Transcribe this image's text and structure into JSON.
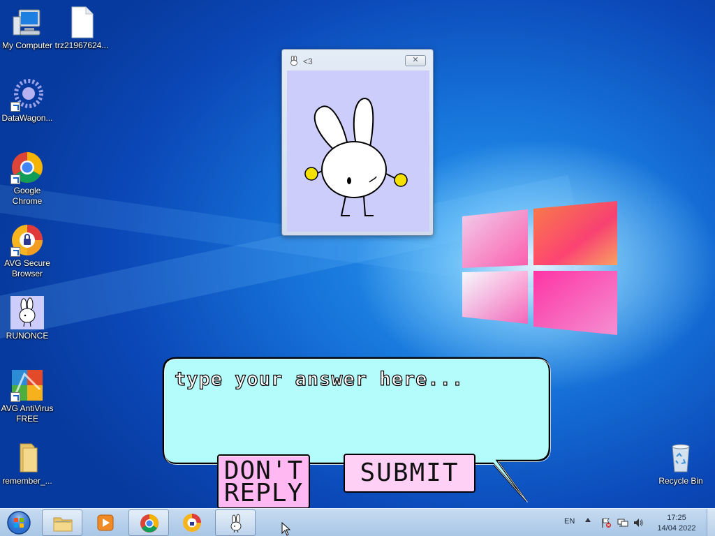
{
  "desktop": {
    "icons": [
      {
        "label": "My Computer",
        "icon": "computer-icon"
      },
      {
        "label": "trz21967624...",
        "icon": "file-icon"
      },
      {
        "label": "DataWagon...",
        "icon": "datawagon-icon"
      },
      {
        "label": "Google Chrome",
        "icon": "chrome-icon"
      },
      {
        "label": "AVG Secure Browser",
        "icon": "avg-secure-browser-icon"
      },
      {
        "label": "RUNONCE",
        "icon": "bunny-icon"
      },
      {
        "label": "AVG AntiVirus FREE",
        "icon": "avg-antivirus-icon"
      },
      {
        "label": "remember_...",
        "icon": "folder-icon"
      },
      {
        "label": "Recycle Bin",
        "icon": "recycle-bin-icon"
      }
    ]
  },
  "bunny_window": {
    "title": "<3",
    "close_glyph": "✕"
  },
  "dialog": {
    "answer_placeholder": "type your answer here...",
    "answer_value": "",
    "dont_reply_label": "DON'T REPLY",
    "submit_label": "SUBMIT",
    "bubble_color": "#b4fbfb",
    "button_color": "#ffb8f2"
  },
  "taskbar": {
    "items": [
      {
        "name": "file-explorer",
        "icon": "folder-icon"
      },
      {
        "name": "media-player",
        "icon": "media-player-icon"
      },
      {
        "name": "google-chrome",
        "icon": "chrome-icon"
      },
      {
        "name": "avg-secure-browser",
        "icon": "avg-secure-browser-icon"
      },
      {
        "name": "bunny-app",
        "icon": "bunny-icon",
        "active": true
      }
    ],
    "language": "EN",
    "time": "17:25",
    "date": "14/04 2022"
  }
}
